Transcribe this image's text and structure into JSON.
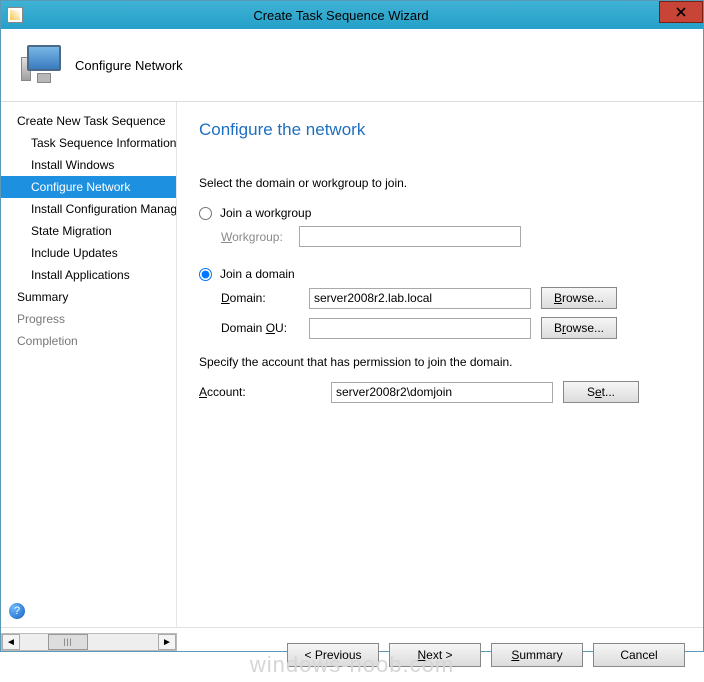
{
  "window": {
    "title": "Create Task Sequence Wizard"
  },
  "header": {
    "text": "Configure Network"
  },
  "sidebar": {
    "items": [
      {
        "label": "Create New Task Sequence",
        "sub": false,
        "active": false,
        "muted": false
      },
      {
        "label": "Task Sequence Information",
        "sub": true,
        "active": false,
        "muted": false
      },
      {
        "label": "Install Windows",
        "sub": true,
        "active": false,
        "muted": false
      },
      {
        "label": "Configure Network",
        "sub": true,
        "active": true,
        "muted": false
      },
      {
        "label": "Install Configuration Manager",
        "sub": true,
        "active": false,
        "muted": false
      },
      {
        "label": "State Migration",
        "sub": true,
        "active": false,
        "muted": false
      },
      {
        "label": "Include Updates",
        "sub": true,
        "active": false,
        "muted": false
      },
      {
        "label": "Install Applications",
        "sub": true,
        "active": false,
        "muted": false
      },
      {
        "label": "Summary",
        "sub": false,
        "active": false,
        "muted": false
      },
      {
        "label": "Progress",
        "sub": false,
        "active": false,
        "muted": true
      },
      {
        "label": "Completion",
        "sub": false,
        "active": false,
        "muted": true
      }
    ]
  },
  "content": {
    "heading": "Configure the network",
    "intro": "Select the domain or workgroup to join.",
    "workgroup_radio_label": "Join a workgroup",
    "workgroup_field_label": "Workgroup:",
    "workgroup_value": "",
    "domain_radio_label": "Join a domain",
    "domain_field_label": "Domain:",
    "domain_value": "server2008r2.lab.local",
    "domain_ou_label": "Domain OU:",
    "domain_ou_value": "",
    "browse_label": "Browse...",
    "permission_note": "Specify the account that has permission to join the domain.",
    "account_label": "Account:",
    "account_value": "server2008r2\\domjoin",
    "set_label": "Set..."
  },
  "footer": {
    "previous": "< Previous",
    "next": "Next >",
    "summary": "Summary",
    "cancel": "Cancel"
  },
  "watermark": "windows-noob.com"
}
